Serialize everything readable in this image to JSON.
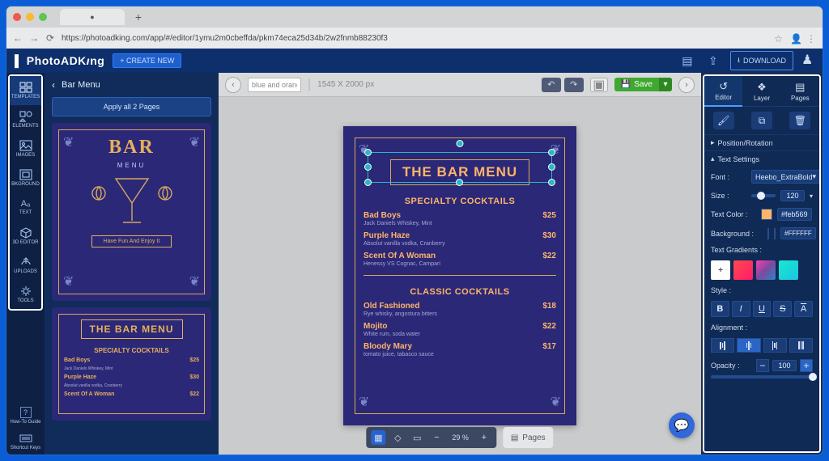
{
  "browser": {
    "url": "https://photoadking.com/app/#/editor/1ymu2m0cbeffda/pkm74eca25d34b/2w2fnmb88230f3",
    "tab_title": ""
  },
  "header": {
    "logo": "PhotoADKing",
    "create_new": "+ CREATE NEW",
    "download": "DOWNLOAD"
  },
  "rail": {
    "templates": "TEMPLATES",
    "elements": "ELEMENTS",
    "images": "IMAGES",
    "background": "BKGROUND",
    "text": "TEXT",
    "editor3d": "3D EDITOR",
    "uploads": "UPLOADS",
    "tools": "TOOLS",
    "howto": "How-To Guide",
    "shortcuts": "Shortcut Keys"
  },
  "sidepanel": {
    "title": "Bar Menu",
    "apply": "Apply all 2 Pages",
    "tpl1": {
      "bar": "BAR",
      "menu": "MENU",
      "tag": "Have Fun And Enjoy It"
    },
    "tpl2": {
      "title": "THE BAR MENU",
      "sec": "SPECIALTY COCKTAILS",
      "items": [
        {
          "name": "Bad Boys",
          "sub": "Jack Daniels Whiskey, Mint",
          "price": "$25"
        },
        {
          "name": "Purple Haze",
          "sub": "Absolut vanilla vodka, Cranberry",
          "price": "$30"
        },
        {
          "name": "Scent Of A Woman",
          "price": "$22"
        }
      ]
    }
  },
  "canvas": {
    "name_placeholder": "blue and orang",
    "dims": "1545 X 2000 px",
    "save": "Save",
    "zoom": "29 %",
    "pages": "Pages",
    "menu": {
      "title": "THE BAR MENU",
      "sec1": "SPECIALTY COCKTAILS",
      "items1": [
        {
          "name": "Bad Boys",
          "sub": "Jack Daniels Whiskey, Mint",
          "price": "$25"
        },
        {
          "name": "Purple Haze",
          "sub": "Absolut vanilla vodka, Cranberry",
          "price": "$30"
        },
        {
          "name": "Scent Of A Woman",
          "sub": "Henessy VS Cognac, Campari",
          "price": "$22"
        }
      ],
      "sec2": "CLASSIC COCKTAILS",
      "items2": [
        {
          "name": "Old Fashioned",
          "sub": "Rye whisky, angostura bitters",
          "price": "$18"
        },
        {
          "name": "Mojito",
          "sub": "White rum, soda water",
          "price": "$22"
        },
        {
          "name": "Bloody Mary",
          "sub": "tomato juice, tabasco sauce",
          "price": "$17"
        }
      ]
    }
  },
  "right": {
    "tabs": {
      "editor": "Editor",
      "layer": "Layer",
      "pages": "Pages"
    },
    "pos": "Position/Rotation",
    "text_settings": "Text Settings",
    "font_label": "Font :",
    "font_value": "Heebo_ExtraBold",
    "size_label": "Size :",
    "size_value": "120",
    "textcolor_label": "Text Color :",
    "textcolor_value": "#feb569",
    "bg_label": "Background :",
    "bg_value": "#FFFFFF",
    "gradients_label": "Text Gradients :",
    "style_label": "Style :",
    "alignment_label": "Alignment :",
    "opacity_label": "Opacity :",
    "opacity_value": "100"
  }
}
